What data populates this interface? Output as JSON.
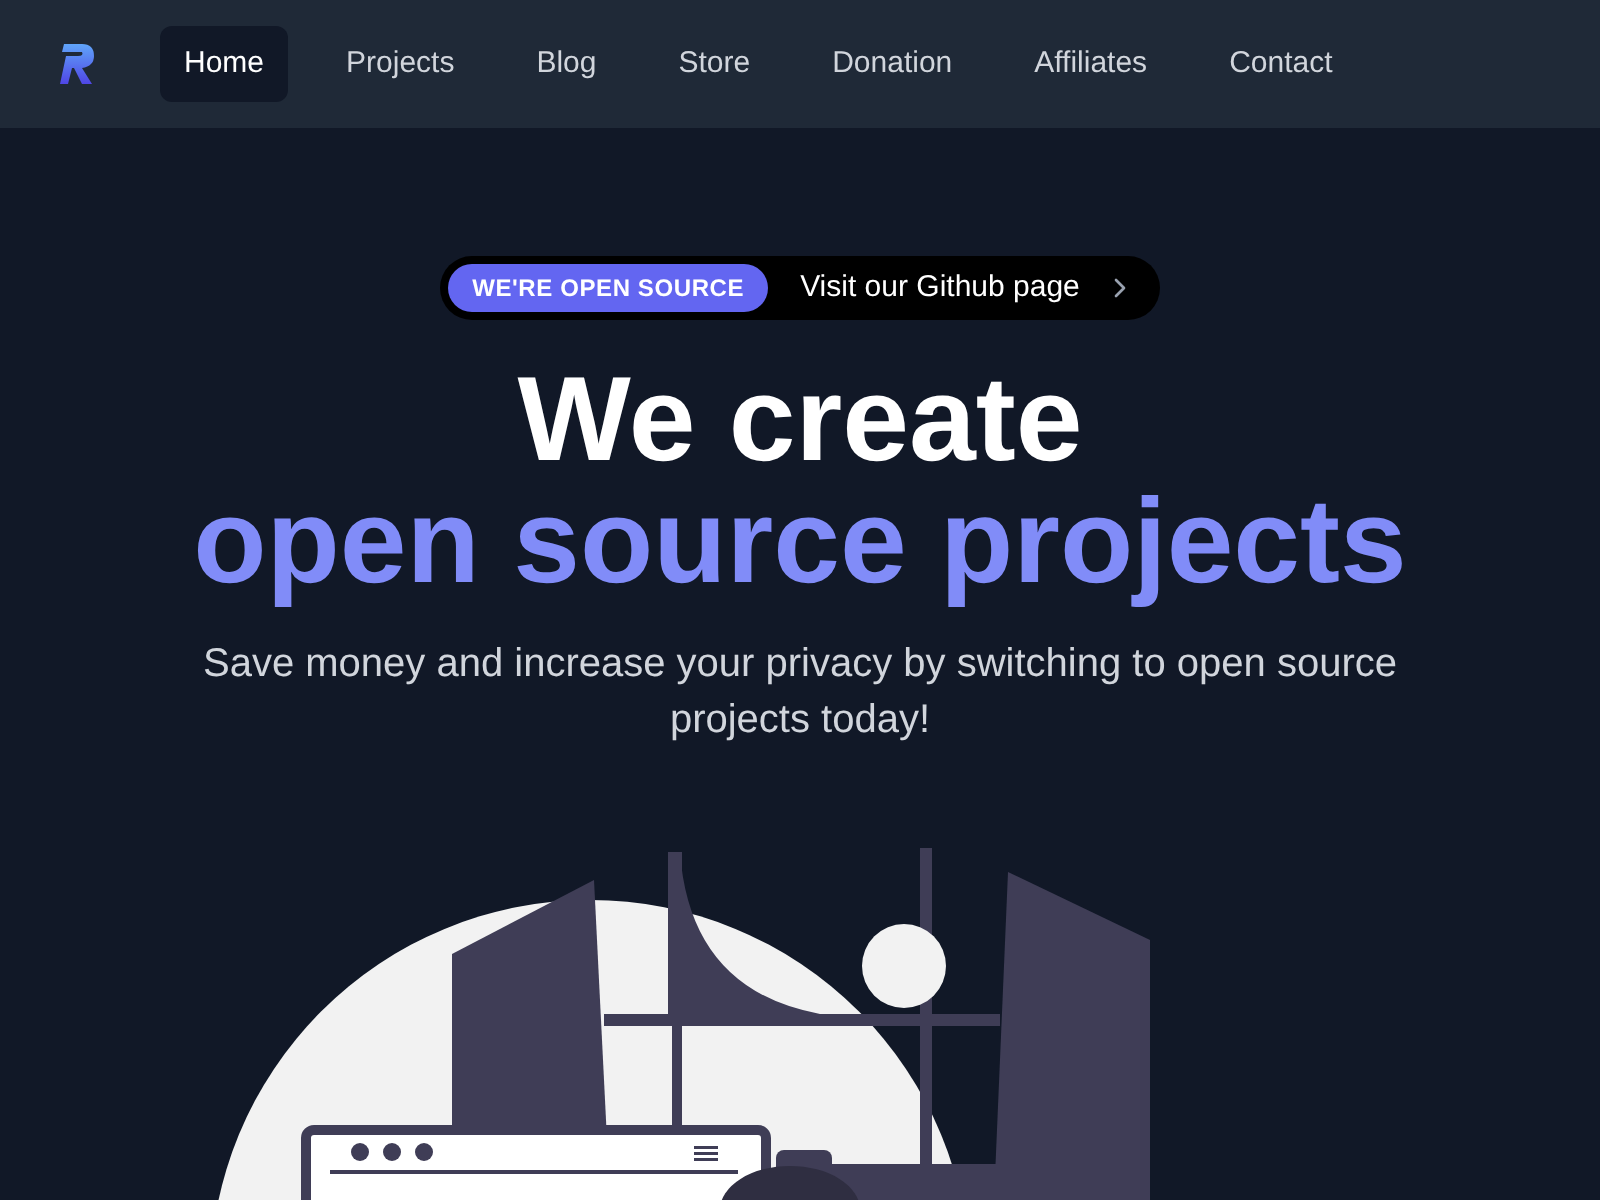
{
  "nav": {
    "items": [
      {
        "label": "Home",
        "selected": true
      },
      {
        "label": "Projects",
        "selected": false
      },
      {
        "label": "Blog",
        "selected": false
      },
      {
        "label": "Store",
        "selected": false
      },
      {
        "label": "Donation",
        "selected": false
      },
      {
        "label": "Affiliates",
        "selected": false
      },
      {
        "label": "Contact",
        "selected": false
      }
    ]
  },
  "hero": {
    "badge": "WE'RE OPEN SOURCE",
    "badge_link": "Visit our Github page",
    "title_line1": "We create",
    "title_line2": "open source projects",
    "subtitle": "Save money and increase your privacy by switching to open source projects today!"
  }
}
